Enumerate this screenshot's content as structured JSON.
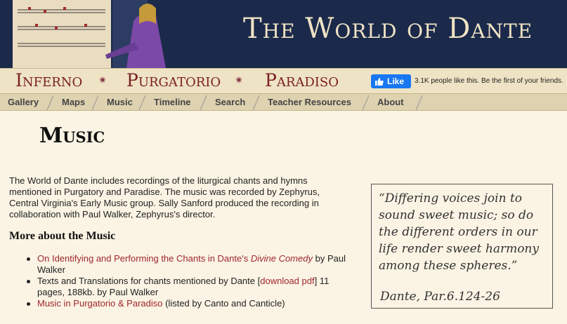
{
  "site": {
    "title": "The World of Dante"
  },
  "realms": [
    "Inferno",
    "Purgatorio",
    "Paradiso"
  ],
  "facebook": {
    "button_label": "Like",
    "text": "3.1K people like this. Be the first of your friends."
  },
  "nav": [
    "Gallery",
    "Maps",
    "Music",
    "Timeline",
    "Search",
    "Teacher Resources",
    "About"
  ],
  "page": {
    "title": "Music",
    "intro": "The World of Dante includes recordings of the liturgical chants and hymns mentioned in Purgatory and Paradise. The music was recorded by Zephyrus, Central Virginia's Early Music group. Sally Sanford produced the recording in collaboration with Paul Walker, Zephyrus's director.",
    "more_heading": "More about the Music",
    "links": [
      {
        "link": "On Identifying and Performing the Chants in Dante's ",
        "link_italic": "Divine Comedy",
        "rest": " by Paul Walker"
      },
      {
        "pre": "Texts and Translations for chants mentioned by Dante [",
        "link": "download pdf",
        "rest": "] 11 pages, 188kb. by Paul Walker"
      },
      {
        "link": "Music in Purgatorio & Paradiso",
        "rest": " (listed by Canto and Canticle)"
      }
    ],
    "quote": "“Differing voices join to sound  sweet music; so do the different orders in our life render sweet harmony among these spheres.”",
    "quote_cite": "Dante, Par.6.124-26"
  },
  "colors": {
    "banner": "#1b2a4b",
    "link": "#a0262e",
    "realm": "#7a1e26",
    "fb": "#1877f2"
  }
}
